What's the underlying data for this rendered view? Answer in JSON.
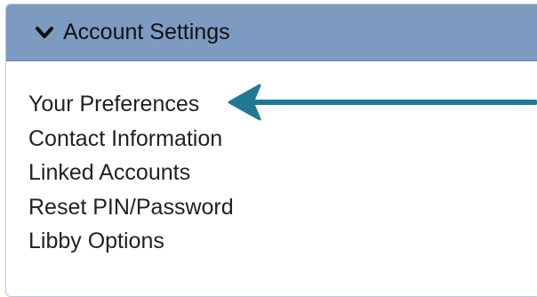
{
  "header": {
    "title": "Account Settings",
    "icon": "chevron-down-icon",
    "background_color": "#7d9bc1"
  },
  "menu": {
    "items": [
      {
        "label": "Your Preferences"
      },
      {
        "label": "Contact Information"
      },
      {
        "label": "Linked Accounts"
      },
      {
        "label": "Reset PIN/Password"
      },
      {
        "label": "Libby Options"
      }
    ]
  },
  "annotation": {
    "icon": "arrow-left-icon",
    "color": "#1f7b93"
  }
}
